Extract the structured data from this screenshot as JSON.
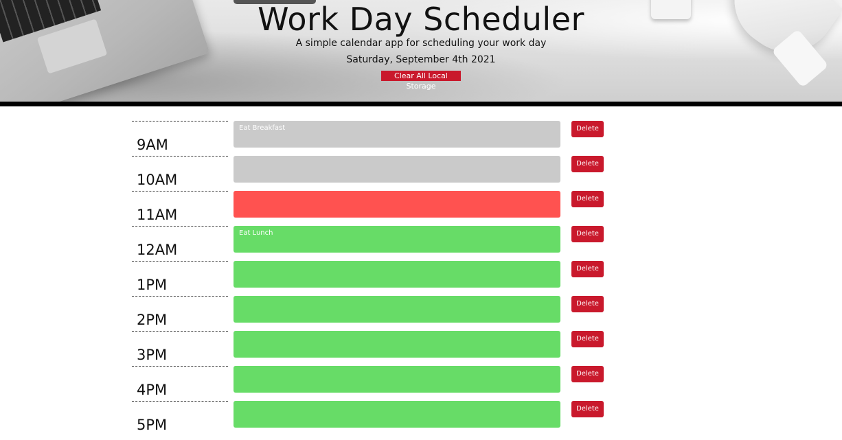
{
  "header": {
    "title": "Work Day Scheduler",
    "subtitle": "A simple calendar app for scheduling your work day",
    "date": "Saturday, September 4th 2021",
    "clear_button": "Clear All Local Storage"
  },
  "colors": {
    "past": "#cacaca",
    "present": "#ff5250",
    "future": "#67dc67",
    "button": "#c9192c"
  },
  "delete_label": "Delete",
  "time_blocks": [
    {
      "hour": "9AM",
      "text": "Eat Breakfast",
      "state": "past"
    },
    {
      "hour": "10AM",
      "text": "",
      "state": "past"
    },
    {
      "hour": "11AM",
      "text": "",
      "state": "present"
    },
    {
      "hour": "12AM",
      "text": "Eat Lunch",
      "state": "future"
    },
    {
      "hour": "1PM",
      "text": "",
      "state": "future"
    },
    {
      "hour": "2PM",
      "text": "",
      "state": "future"
    },
    {
      "hour": "3PM",
      "text": "",
      "state": "future"
    },
    {
      "hour": "4PM",
      "text": "",
      "state": "future"
    },
    {
      "hour": "5PM",
      "text": "",
      "state": "future"
    }
  ]
}
